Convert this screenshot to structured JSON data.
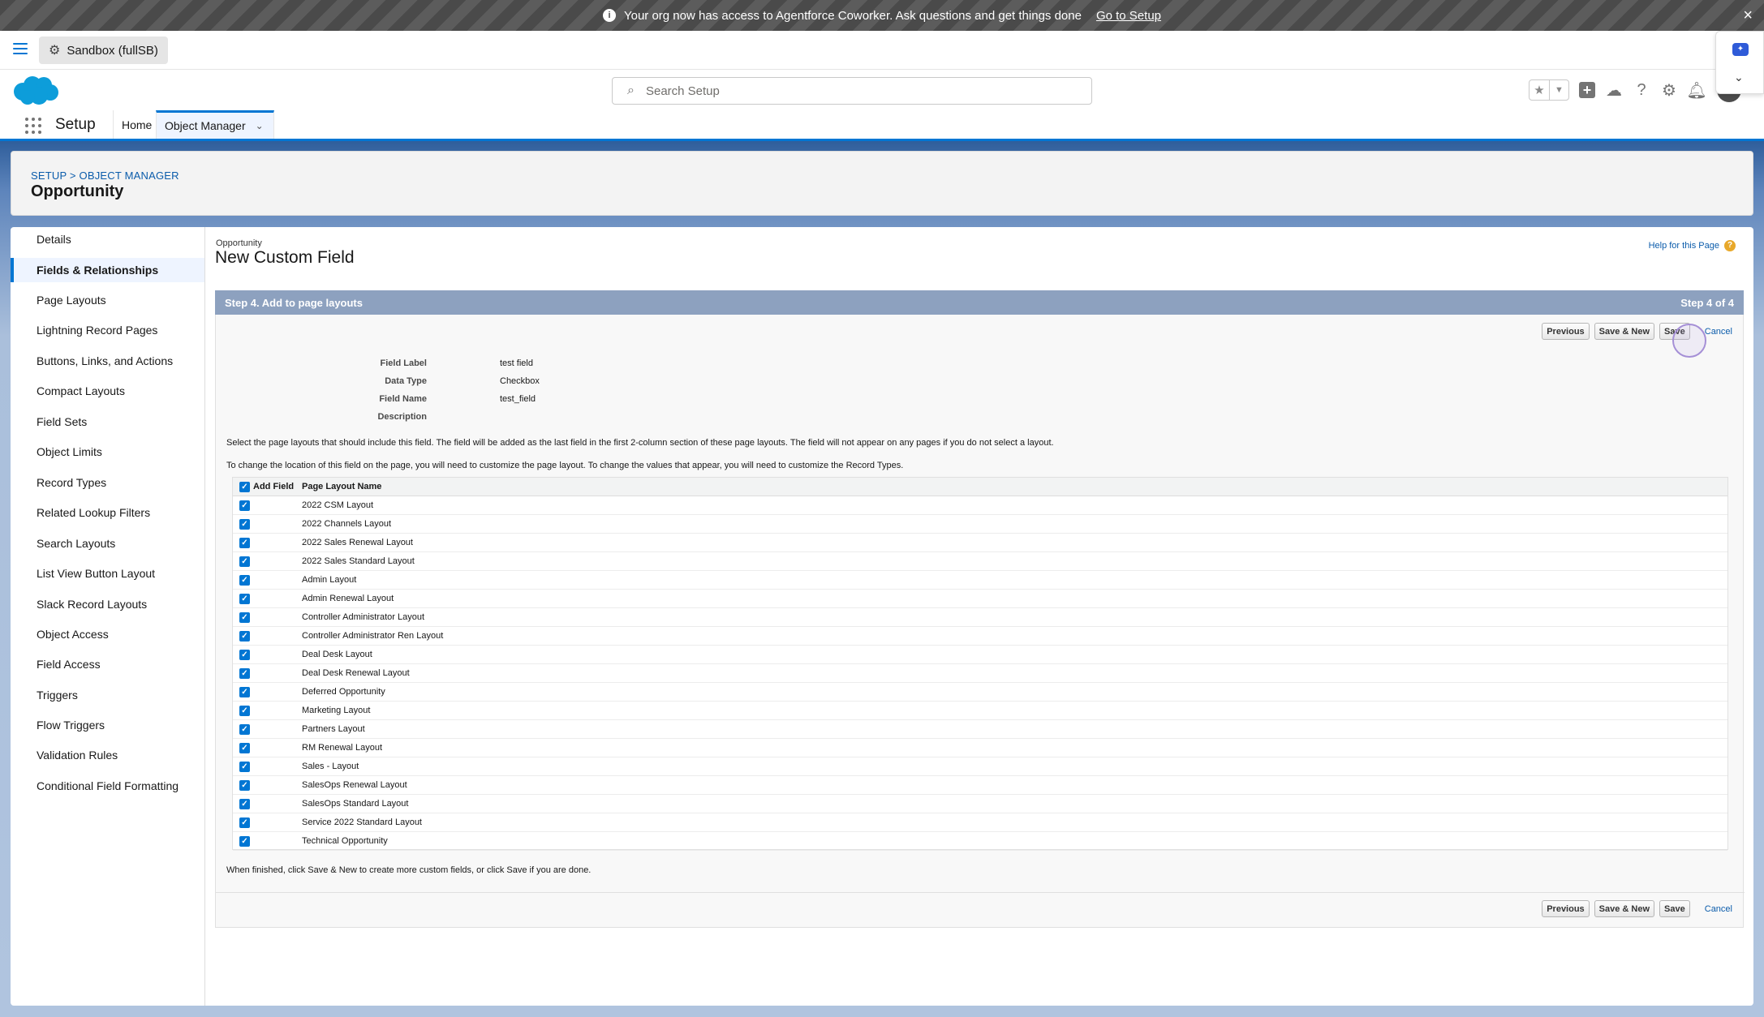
{
  "banner": {
    "message": "Your org now has access to Agentforce Coworker. Ask questions and get things done",
    "link": "Go to Setup"
  },
  "sandbox": {
    "label": "Sandbox (fullSB)"
  },
  "search": {
    "placeholder": "Search Setup"
  },
  "nav": {
    "app_name": "Setup",
    "tabs": [
      "Home",
      "Object Manager"
    ]
  },
  "page_header": {
    "breadcrumb": "SETUP > OBJECT MANAGER",
    "title": "Opportunity"
  },
  "sidebar": {
    "items": [
      "Details",
      "Fields & Relationships",
      "Page Layouts",
      "Lightning Record Pages",
      "Buttons, Links, and Actions",
      "Compact Layouts",
      "Field Sets",
      "Object Limits",
      "Record Types",
      "Related Lookup Filters",
      "Search Layouts",
      "List View Button Layout",
      "Slack Record Layouts",
      "Object Access",
      "Field Access",
      "Triggers",
      "Flow Triggers",
      "Validation Rules",
      "Conditional Field Formatting"
    ],
    "active_index": 1
  },
  "form": {
    "object_label": "Opportunity",
    "title": "New Custom Field",
    "help_link": "Help for this Page",
    "step_title": "Step 4. Add to page layouts",
    "step_counter": "Step 4 of 4",
    "buttons": {
      "previous": "Previous",
      "save_new": "Save & New",
      "save": "Save",
      "cancel": "Cancel"
    },
    "fields": [
      {
        "label": "Field Label",
        "value": "test field"
      },
      {
        "label": "Data Type",
        "value": "Checkbox"
      },
      {
        "label": "Field Name",
        "value": "test_field"
      },
      {
        "label": "Description",
        "value": ""
      }
    ],
    "instruction_1": "Select the page layouts that should include this field. The field will be added as the last field in the first 2-column section of these page layouts. The field will not appear on any pages if you do not select a layout.",
    "instruction_2": "To change the location of this field on the page, you will need to customize the page layout. To change the values that appear, you will need to customize the Record Types.",
    "table": {
      "col_add": "Add Field",
      "col_name": "Page Layout Name",
      "rows": [
        "2022 CSM Layout",
        "2022 Channels Layout",
        "2022 Sales Renewal Layout",
        "2022 Sales Standard Layout",
        "Admin Layout",
        "Admin Renewal Layout",
        "Controller Administrator Layout",
        "Controller Administrator Ren Layout",
        "Deal Desk Layout",
        "Deal Desk Renewal Layout",
        "Deferred Opportunity",
        "Marketing Layout",
        "Partners Layout",
        "RM Renewal Layout",
        "Sales - Layout",
        "SalesOps Renewal Layout",
        "SalesOps Standard Layout",
        "Service 2022 Standard Layout",
        "Technical Opportunity"
      ]
    },
    "finish_note": "When finished, click Save & New to create more custom fields, or click Save if you are done."
  },
  "colors": {
    "brand_blue": "#0176d3",
    "step_bar": "#8da1bf",
    "banner_bg": "#4a4a4a"
  }
}
